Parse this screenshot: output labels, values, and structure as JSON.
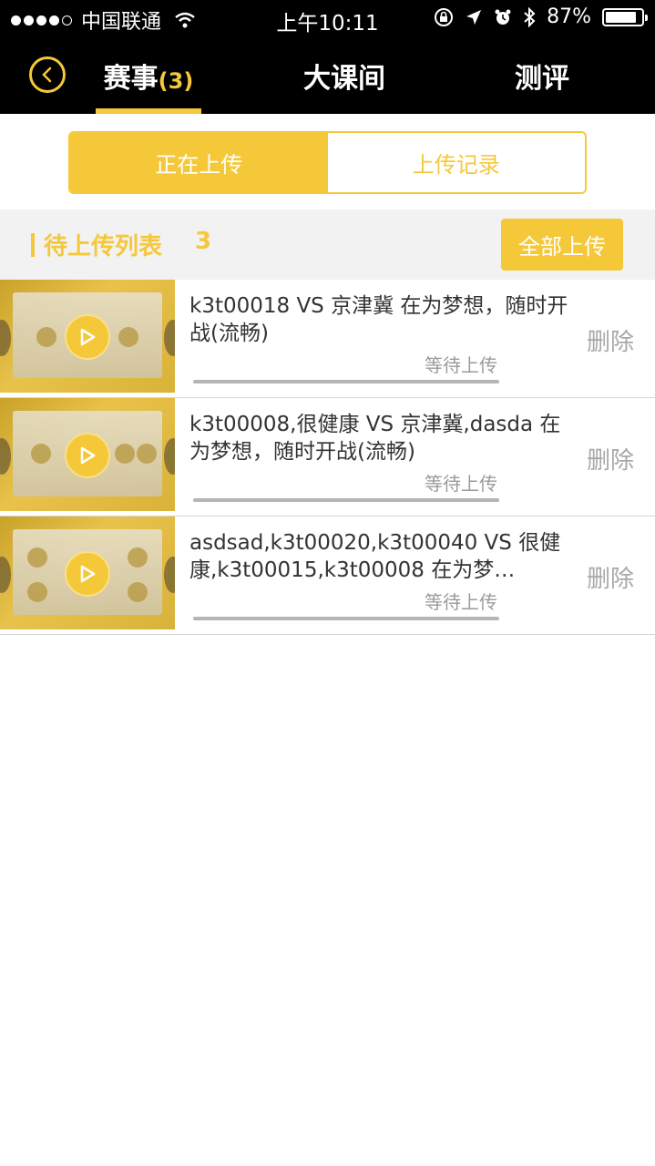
{
  "status_bar": {
    "carrier": "中国联通",
    "time": "上午10:11",
    "battery": "87%",
    "battery_level": 0.87
  },
  "nav": {
    "tabs": [
      {
        "label": "赛事",
        "count": "(3)",
        "active": true
      },
      {
        "label": "大课间"
      },
      {
        "label": "测评"
      }
    ]
  },
  "segment": {
    "active": "正在上传",
    "inactive": "上传记录"
  },
  "section": {
    "title": "待上传列表",
    "count": "3",
    "upload_all": "全部上传"
  },
  "items": [
    {
      "title": "k3t00018 VS 京津冀 在为梦想，随时开战(流畅)",
      "status": "等待上传",
      "delete": "删除",
      "progress": 0
    },
    {
      "title": "k3t00008,很健康 VS 京津冀,dasda 在为梦想，随时开战(流畅)",
      "status": "等待上传",
      "delete": "删除",
      "progress": 0
    },
    {
      "title": "asdsad,k3t00020,k3t00040 VS 很健康,k3t00015,k3t00008 在为梦…",
      "status": "等待上传",
      "delete": "删除",
      "progress": 0
    }
  ],
  "colors": {
    "accent": "#f5c83a",
    "navbar": "#000000"
  }
}
